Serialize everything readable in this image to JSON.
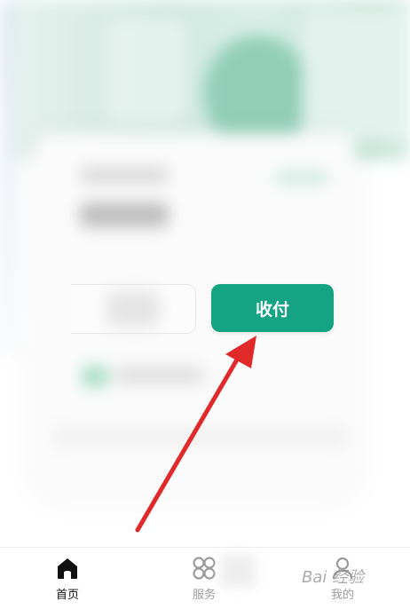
{
  "pay_button": {
    "label": "收付"
  },
  "tabs": [
    {
      "label": "首页",
      "icon": "home-icon",
      "active": true
    },
    {
      "label": "服务",
      "icon": "grid-icon",
      "active": false
    },
    {
      "label": "我的",
      "icon": "profile-icon",
      "active": false
    }
  ],
  "watermark": {
    "text": "Bai 经验"
  },
  "colors": {
    "accent": "#14a383",
    "arrow": "#e02a2a",
    "tab_active": "#111111",
    "tab_inactive": "#9b9b9b"
  }
}
